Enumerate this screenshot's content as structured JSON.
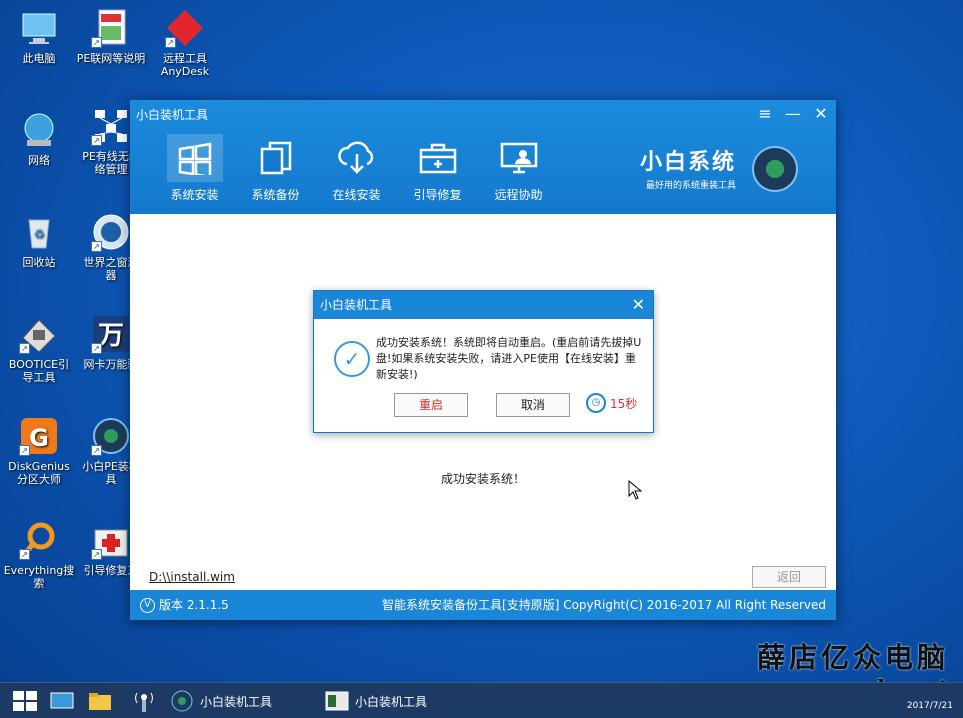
{
  "desktop": {
    "icons": [
      {
        "label": "此电脑"
      },
      {
        "label": "PE联网等说明"
      },
      {
        "label": "远程工具\nAnyDesk"
      },
      {
        "label": "网络"
      },
      {
        "label": "PE有线无线\n络管理"
      },
      {
        "label": "回收站"
      },
      {
        "label": "世界之窗浏\n器"
      },
      {
        "label": "BOOTICE引\n导工具"
      },
      {
        "label": "网卡万能驱"
      },
      {
        "label": "DiskGenius\n分区大师"
      },
      {
        "label": "小白PE装机\n具"
      },
      {
        "label": "Everything搜\n索"
      },
      {
        "label": "引导修复工"
      }
    ]
  },
  "window": {
    "title": "小白装机工具",
    "controls": {
      "menu": "≡",
      "minimize": "—",
      "close": "✕"
    },
    "nav": [
      {
        "label": "系统安装",
        "icon": "windows-icon"
      },
      {
        "label": "系统备份",
        "icon": "copy-icon"
      },
      {
        "label": "在线安装",
        "icon": "cloud-download-icon"
      },
      {
        "label": "引导修复",
        "icon": "toolbox-icon"
      },
      {
        "label": "远程协助",
        "icon": "remote-monitor-icon"
      }
    ],
    "brand": {
      "name": "小白系统",
      "subtitle": "最好用的系统重装工具"
    },
    "status_text": "成功安装系统！",
    "path": "D:\\\\install.wim",
    "back_label": "返回",
    "footer": {
      "version": "版本 2.1.1.5",
      "right": "智能系统安装备份工具[支持原版]   CopyRight(C) 2016-2017 All Right Reserved"
    }
  },
  "dialog": {
    "title": "小白装机工具",
    "message": "成功安装系统！系统即将自动重启。(重启前请先拔掉U盘!如果系统安装失败，请进入PE使用【在线安装】重新安装!)",
    "restart_label": "重启",
    "cancel_label": "取消",
    "countdown": "15秒"
  },
  "taskbar": {
    "items": [
      {
        "label": "小白装机工具"
      },
      {
        "label": "小白装机工具"
      }
    ],
    "clock": "2017/7/21"
  },
  "watermark": {
    "cn": "薛店亿众电脑",
    "url": "www.yzdn.net"
  }
}
